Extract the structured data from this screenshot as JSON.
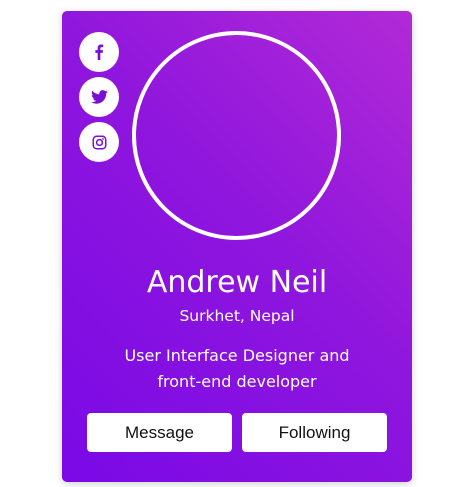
{
  "profile": {
    "name": "Andrew Neil",
    "location": "Surkhet, Nepal",
    "bio_line1": "User Interface Designer and",
    "bio_line2": "front-end developer"
  },
  "social": [
    {
      "icon": "facebook-icon"
    },
    {
      "icon": "twitter-icon"
    },
    {
      "icon": "instagram-icon"
    }
  ],
  "actions": {
    "message_label": "Message",
    "following_label": "Following"
  },
  "colors": {
    "gradient_start": "#b22ad6",
    "gradient_end": "#7a09e6",
    "icon_color": "#7a0fd6",
    "button_bg": "#ffffff"
  }
}
